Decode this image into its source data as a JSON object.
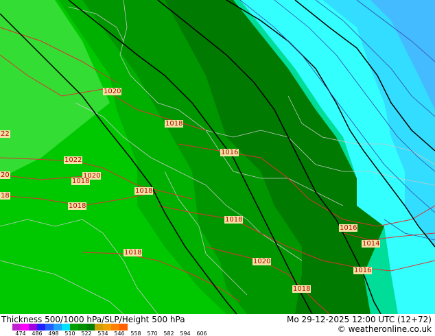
{
  "map": {
    "pressure_labels": [
      "1020",
      "1018",
      "1016",
      "1022",
      "1020",
      "1018",
      "1018",
      "1018",
      "1018",
      "1018",
      "1016",
      "1014",
      "1016",
      "1020",
      "1018",
      "22",
      "20",
      "18"
    ]
  },
  "footer": {
    "title": "Thickness 500/1000 hPa/SLP/Height 500 hPa",
    "datetime": "Mo 29-12-2025 12:00 UTC (12+72)",
    "credit": "© weatheronline.co.uk",
    "colorbar": {
      "colors": [
        "#c020d0",
        "#ff00ff",
        "#a000e0",
        "#2020ff",
        "#2060ff",
        "#20a0ff",
        "#00e0ff",
        "#00a000",
        "#009000",
        "#008000",
        "#d0a000",
        "#f0a000",
        "#ff8000",
        "#ff6000"
      ],
      "ticks": [
        "474",
        "486",
        "498",
        "510",
        "522",
        "534",
        "546",
        "558",
        "570",
        "582",
        "594",
        "606"
      ]
    }
  }
}
